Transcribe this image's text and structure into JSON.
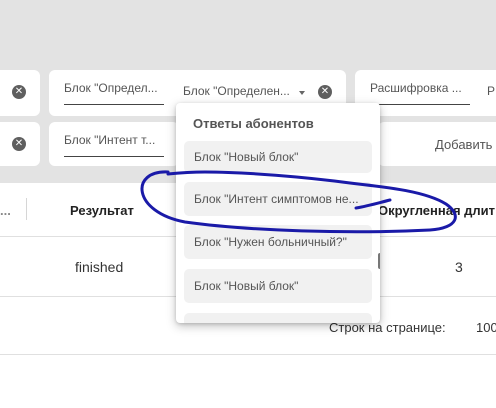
{
  "filters": {
    "row1": {
      "field1_label": "Блок \"Определ...",
      "field2_label": "Блок \"Определен...",
      "field3_label": "Расшифровка ...",
      "field4_label": "Р"
    },
    "row2": {
      "field1_label": "Блок \"Интент т...",
      "add_label": "Добавить"
    }
  },
  "table": {
    "headers": {
      "col1": "...",
      "result": "Результат",
      "rounded": "Округленная длит"
    },
    "row": {
      "result": "finished",
      "rounded": "3"
    }
  },
  "pagination": {
    "rows_label": "Строк на странице:",
    "rows_value": "100"
  },
  "dropdown": {
    "title": "Ответы абонентов",
    "items": [
      "Блок \"Новый блок\"",
      "Блок \"Интент симптомов не...",
      "Блок \"Нужен больничный?\"",
      "Блок \"Новый блок\""
    ]
  },
  "icons": {
    "clear": "clear-circle-x-icon",
    "caret": "caret-down-icon"
  },
  "colors": {
    "annotation": "#1a1aa8",
    "top_band": "#e3e3e3"
  }
}
